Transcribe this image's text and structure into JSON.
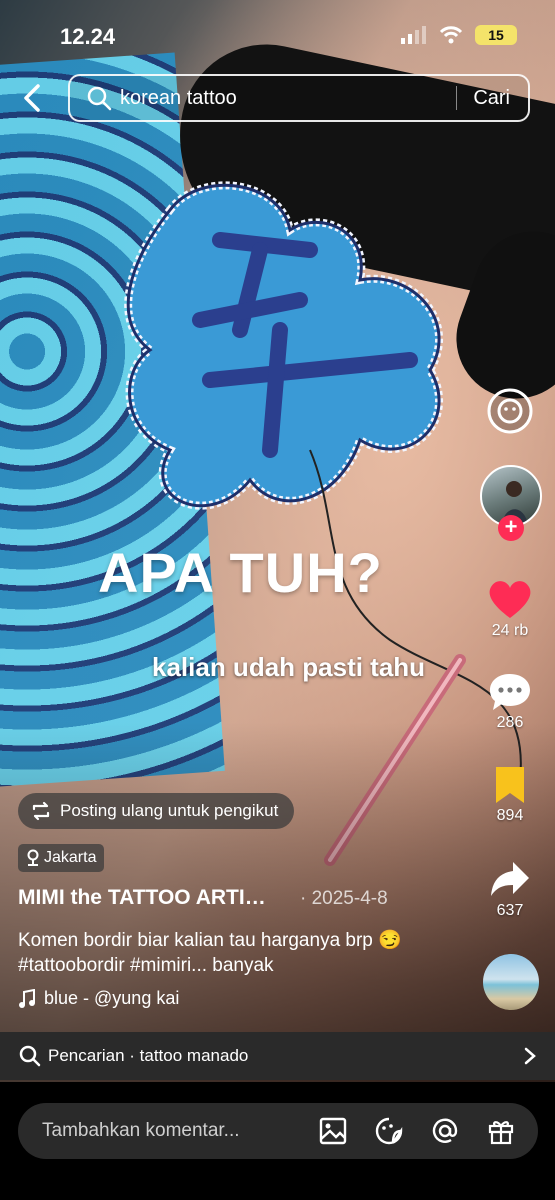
{
  "status": {
    "time": "12.24",
    "battery": "15"
  },
  "search": {
    "query": "korean tattoo",
    "submit": "Cari"
  },
  "video_overlay": {
    "title": "APA TUH?",
    "subtitle": "kalian udah pasti tahu"
  },
  "actions": {
    "likes": "24 rb",
    "comments": "286",
    "saves": "894",
    "shares": "637"
  },
  "post": {
    "repost_label": "Posting ulang untuk pengikut",
    "location": "Jakarta",
    "author": "MIMI the TATTOO ARTI…",
    "date": "· 2025-4-8",
    "caption": "Komen bordir biar kalian tau harganya brp 😏 #tattoobordir #mimiri... banyak",
    "music": "blue - @yung kai"
  },
  "related_search": {
    "label": "Pencarian · tattoo manado"
  },
  "comment": {
    "placeholder": "Tambahkan komentar..."
  },
  "colors": {
    "like": "#fe2c55",
    "save": "#f8c21c",
    "follow": "#fe2c55"
  }
}
